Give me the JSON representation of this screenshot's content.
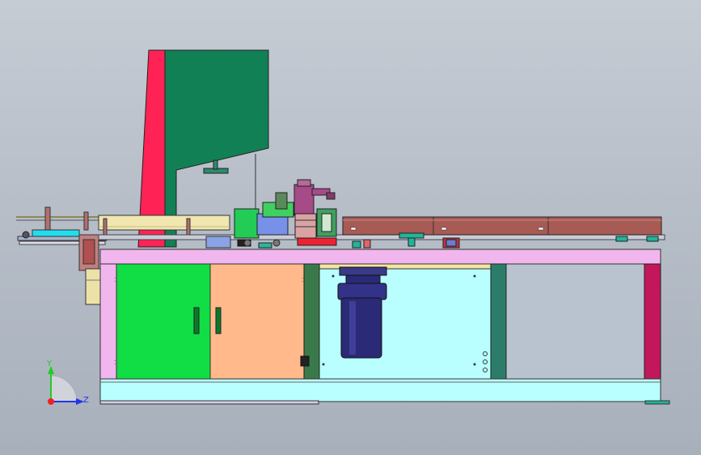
{
  "axis_triad": {
    "y_label": "Y",
    "z_label": "Z",
    "colors": {
      "y": "#22cc22",
      "z": "#2233ee",
      "origin": "#ee2222"
    }
  },
  "colors": {
    "background": "#b7bec8",
    "frame_pink": "#f2b6ee",
    "door_green": "#11dd44",
    "door_peach": "#ffb98a",
    "cabinet_cyan": "#b9ffff",
    "tower_red": "#ff2255",
    "tower_green": "#128055",
    "motor_blue": "#2a2a77",
    "conveyor_brown": "#a85a55",
    "wood_beige": "#f0e6b0"
  }
}
